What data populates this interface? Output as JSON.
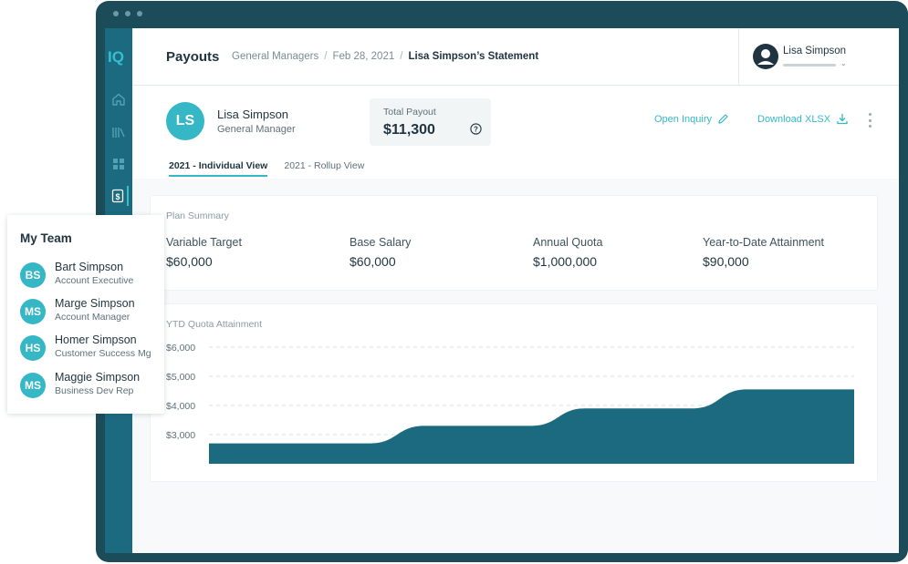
{
  "app": {
    "logo": "IQ"
  },
  "sidebar": {
    "items": [
      {
        "icon": "home-icon"
      },
      {
        "icon": "library-icon"
      },
      {
        "icon": "dashboard-grid-icon"
      },
      {
        "icon": "statement-dollar-icon",
        "active": true
      }
    ]
  },
  "header": {
    "title": "Payouts",
    "breadcrumb": [
      "General Managers",
      "Feb 28, 2021",
      "Lisa Simpson’s Statement"
    ],
    "user_name": "Lisa Simpson"
  },
  "statement": {
    "initials": "LS",
    "name": "Lisa Simpson",
    "role": "General Manager",
    "total_payout_label": "Total Payout",
    "total_payout_value": "$11,300",
    "open_inquiry": "Open Inquiry",
    "download": "Download XLSX",
    "tabs": [
      "2021 - Individual View",
      "2021 - Rollup View"
    ]
  },
  "summary": {
    "title": "Plan Summary",
    "metrics": [
      {
        "label": "Variable Target",
        "value": "$60,000"
      },
      {
        "label": "Base Salary",
        "value": "$60,000"
      },
      {
        "label": "Annual Quota",
        "value": "$1,000,000"
      },
      {
        "label": "Year-to-Date Attainment",
        "value": "$90,000"
      }
    ]
  },
  "chart": {
    "title": "YTD  Quota Attainment"
  },
  "chart_data": {
    "type": "area",
    "title": "YTD  Quota Attainment",
    "xlabel": "",
    "ylabel": "",
    "y_ticks": [
      "$6,000",
      "$5,000",
      "$4,000",
      "$3,000"
    ],
    "ylim": [
      2000,
      6500
    ],
    "grid": "dashed horizontal",
    "color": "#1c6a80",
    "x": [
      0,
      1,
      2,
      3,
      4,
      5,
      6,
      7,
      8,
      9,
      10,
      11,
      12
    ],
    "values": [
      2700,
      2700,
      2700,
      2700,
      3300,
      3300,
      3300,
      3900,
      3900,
      3900,
      4550,
      4550,
      4550
    ]
  },
  "team": {
    "title": "My Team",
    "members": [
      {
        "initials": "BS",
        "name": "Bart Simpson",
        "role": "Account Executive"
      },
      {
        "initials": "MS",
        "name": "Marge Simpson",
        "role": "Account Manager"
      },
      {
        "initials": "HS",
        "name": "Homer Simpson",
        "role": "Customer Success Mg"
      },
      {
        "initials": "MS",
        "name": "Maggie Simpson",
        "role": "Business Dev Rep"
      }
    ]
  },
  "colors": {
    "frame": "#1c4c5a",
    "sidebar": "#1c6a80",
    "accent": "#35b7c6",
    "chart_fill": "#1c6a80"
  }
}
